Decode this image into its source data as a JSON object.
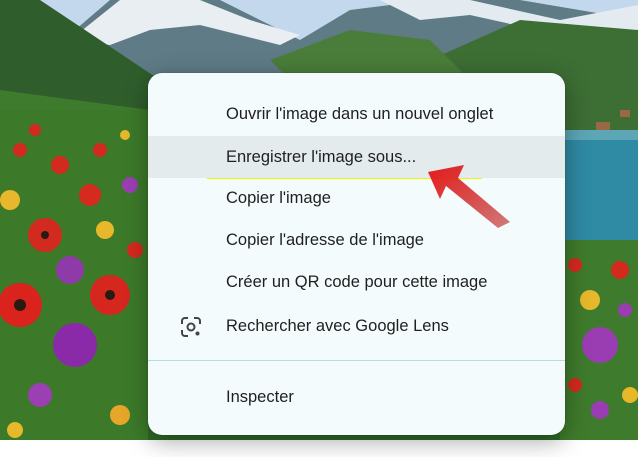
{
  "context_menu": {
    "items": [
      {
        "label": "Ouvrir l'image dans un nouvel onglet"
      },
      {
        "label": "Enregistrer l'image sous..."
      },
      {
        "label": "Copier l'image"
      },
      {
        "label": "Copier l'adresse de l'image"
      },
      {
        "label": "Créer un QR code pour cette image"
      },
      {
        "label": "Rechercher avec Google Lens",
        "icon": "google-lens-icon"
      },
      {
        "label": "Inspecter"
      }
    ],
    "hovered_item": "Enregistrer l'image sous...",
    "highlight_color": "#eef700"
  },
  "annotation": {
    "arrow_color": "#e01b1b",
    "points_to": "Enregistrer l'image sous..."
  }
}
